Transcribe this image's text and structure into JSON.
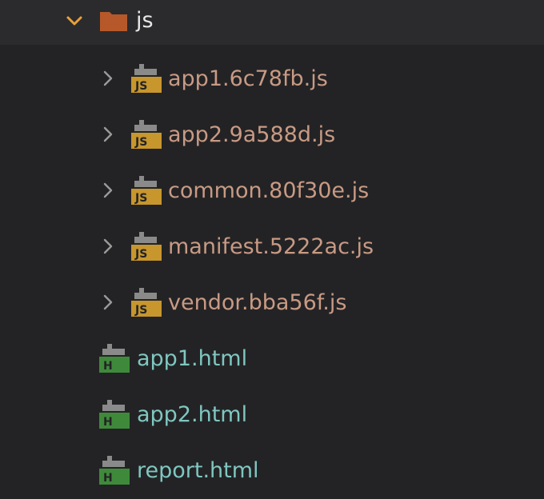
{
  "folder": {
    "name": "js",
    "expanded": true,
    "icon": "folder-icon",
    "color": "#b6582a"
  },
  "js_files": [
    {
      "name": "app1.6c78fb.js",
      "badge": "JS"
    },
    {
      "name": "app2.9a588d.js",
      "badge": "JS"
    },
    {
      "name": "common.80f30e.js",
      "badge": "JS"
    },
    {
      "name": "manifest.5222ac.js",
      "badge": "JS"
    },
    {
      "name": "vendor.bba56f.js",
      "badge": "JS"
    }
  ],
  "html_files": [
    {
      "name": "app1.html",
      "badge": "H"
    },
    {
      "name": "app2.html",
      "badge": "H"
    },
    {
      "name": "report.html",
      "badge": "H"
    }
  ],
  "colors": {
    "background": "#232325",
    "folder_row": "#2b2b2d",
    "chevron_expanded": "#e8a13a",
    "chevron_collapsed": "#9a9a9a",
    "js_badge": "#c7962d",
    "html_badge": "#3f8a3a",
    "js_text": "#c89a84",
    "html_text": "#7fc7c0"
  }
}
